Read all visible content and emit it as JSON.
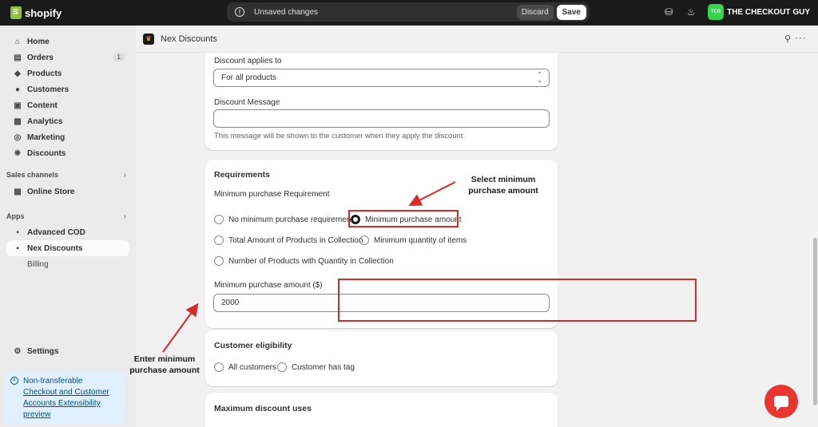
{
  "topbar": {
    "logo_text": "shopify",
    "unsaved_text": "Unsaved changes",
    "discard_label": "Discard",
    "save_label": "Save",
    "avatar_initials": "TCG",
    "store_name": "THE CHECKOUT GUY"
  },
  "sidebar": {
    "items": [
      {
        "label": "Home"
      },
      {
        "label": "Orders",
        "badge": "1"
      },
      {
        "label": "Products"
      },
      {
        "label": "Customers"
      },
      {
        "label": "Content"
      },
      {
        "label": "Analytics"
      },
      {
        "label": "Marketing"
      },
      {
        "label": "Discounts"
      }
    ],
    "sales_channels_label": "Sales channels",
    "online_store_label": "Online Store",
    "apps_label": "Apps",
    "advanced_cod_label": "Advanced COD",
    "nex_discounts_label": "Nex Discounts",
    "billing_label": "Billing",
    "settings_label": "Settings",
    "notice": {
      "line1": "Non-transferable",
      "link": "Checkout and Customer Accounts Extensibility preview"
    }
  },
  "appbar": {
    "title": "Nex Discounts"
  },
  "form": {
    "applies_to_label": "Discount applies to",
    "applies_to_value": "For all products",
    "message_label": "Discount Message",
    "message_value": "",
    "message_help": "This message will be shown to the customer when they apply the discount.",
    "requirements_title": "Requirements",
    "min_req_label": "Minimum purchase Requirement",
    "options": [
      {
        "label": "No minimum purchase requirement",
        "selected": false
      },
      {
        "label": "Minimum purchase amount",
        "selected": true
      },
      {
        "label": "Total Amount of Products in Collection",
        "selected": false
      },
      {
        "label": "Minimum quantity of items",
        "selected": false
      },
      {
        "label": "Number of Products with Quantity in Collection",
        "selected": false
      }
    ],
    "min_amount_label": "Minimum purchase amount ($)",
    "min_amount_value": "2000",
    "eligibility_title": "Customer eligibility",
    "eligibility_options": [
      {
        "label": "All customers",
        "selected": false
      },
      {
        "label": "Customer has tag",
        "selected": false
      }
    ],
    "max_uses_title": "Maximum discount uses"
  },
  "annotations": {
    "select_line1": "Select minimum",
    "select_line2": "purchase amount",
    "enter_line1": "Enter minimum",
    "enter_line2": "purchase amount"
  },
  "colors": {
    "accent_red": "#d92a2a",
    "avatar_green": "#36d34d",
    "chat_red": "#e8352e"
  }
}
